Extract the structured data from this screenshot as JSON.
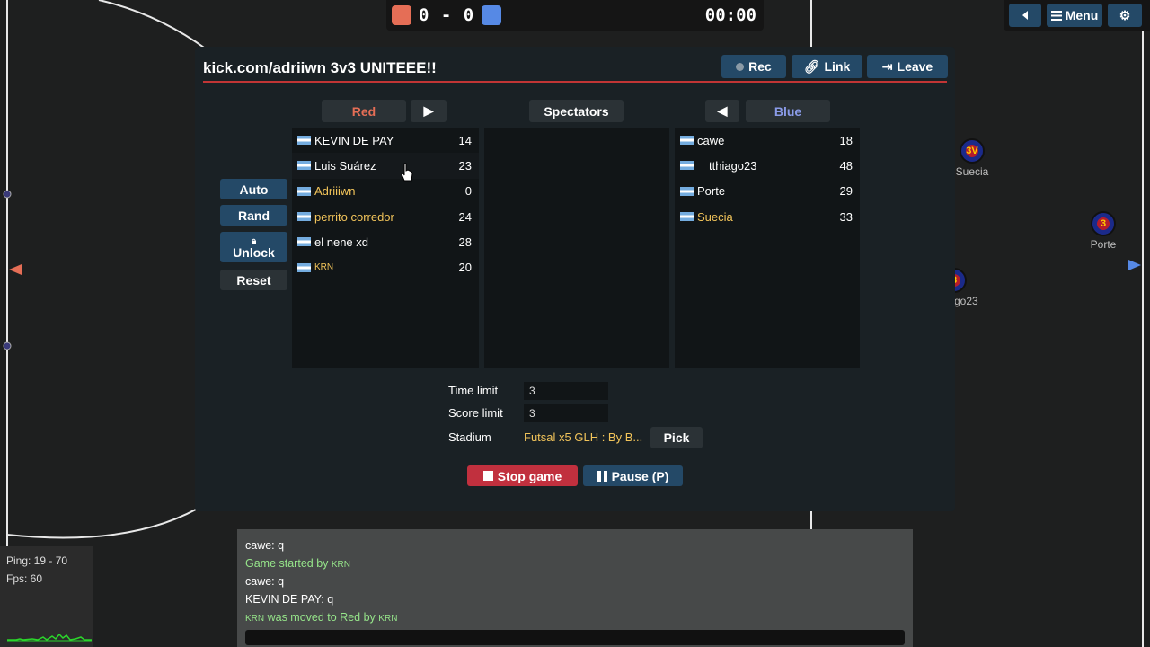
{
  "scorebar": {
    "score": "0 - 0",
    "timer": "00:00",
    "red_color": "#e56e56",
    "blue_color": "#5689e5"
  },
  "top_buttons": {
    "sound_icon": "speaker-icon",
    "menu_label": "Menu",
    "settings_icon": "gear-icon"
  },
  "field_players": [
    {
      "name": "Suecia",
      "number": "3V"
    },
    {
      "name": "Porte",
      "number": "3"
    },
    {
      "name": "go23",
      "number": "3"
    }
  ],
  "dialog": {
    "title": "kick.com/adriiwn 3v3 UNITEEE!!",
    "rec_label": "Rec",
    "link_label": "Link",
    "leave_label": "Leave",
    "red_label": "Red",
    "spectators_label": "Spectators",
    "blue_label": "Blue",
    "side_buttons": {
      "auto": "Auto",
      "rand": "Rand",
      "unlock": "Unlock",
      "reset": "Reset"
    },
    "red_players": [
      {
        "name": "KEVIN DE PAY",
        "score": "14"
      },
      {
        "name": "Luis Suárez",
        "score": "23"
      },
      {
        "name": "Adriiiwn",
        "score": "0"
      },
      {
        "name": "perrito corredor",
        "score": "24"
      },
      {
        "name": "el nene xd",
        "score": "28"
      },
      {
        "name": "KRN",
        "score": "20"
      }
    ],
    "blue_players": [
      {
        "name": "cawe",
        "score": "18"
      },
      {
        "name": "tthiago23",
        "score": "48"
      },
      {
        "name": "Porte",
        "score": "29"
      },
      {
        "name": "Suecia",
        "score": "33"
      }
    ],
    "settings": {
      "time_limit_label": "Time limit",
      "time_limit": "3",
      "score_limit_label": "Score limit",
      "score_limit": "3",
      "stadium_label": "Stadium",
      "stadium": "Futsal x5 GLH : By B...",
      "pick_label": "Pick"
    },
    "stop_label": "Stop game",
    "pause_label": "Pause (P)"
  },
  "chat": {
    "lines": [
      "cawe: q",
      "Game started by",
      "KRN",
      "cawe: q",
      "KEVIN DE PAY: q",
      "was moved to Red by"
    ]
  },
  "stats": {
    "ping": "Ping: 19 - 70",
    "fps": "Fps: 60"
  }
}
